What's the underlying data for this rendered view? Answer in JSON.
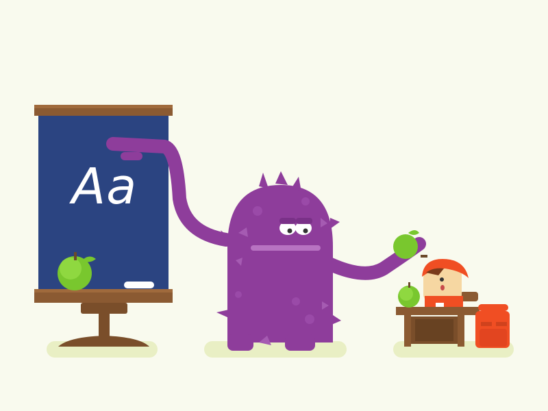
{
  "blackboard": {
    "text": "Aa"
  },
  "colors": {
    "background": "#f9faee",
    "board": "#2b4481",
    "wood": "#8b5a32",
    "monster": "#8e3d9b",
    "apple": "#79c72e",
    "backpack": "#f04e23",
    "shadow": "#e9efc4"
  },
  "icons": [
    "blackboard",
    "apple",
    "monster",
    "child",
    "desk",
    "backpack",
    "chalk"
  ]
}
